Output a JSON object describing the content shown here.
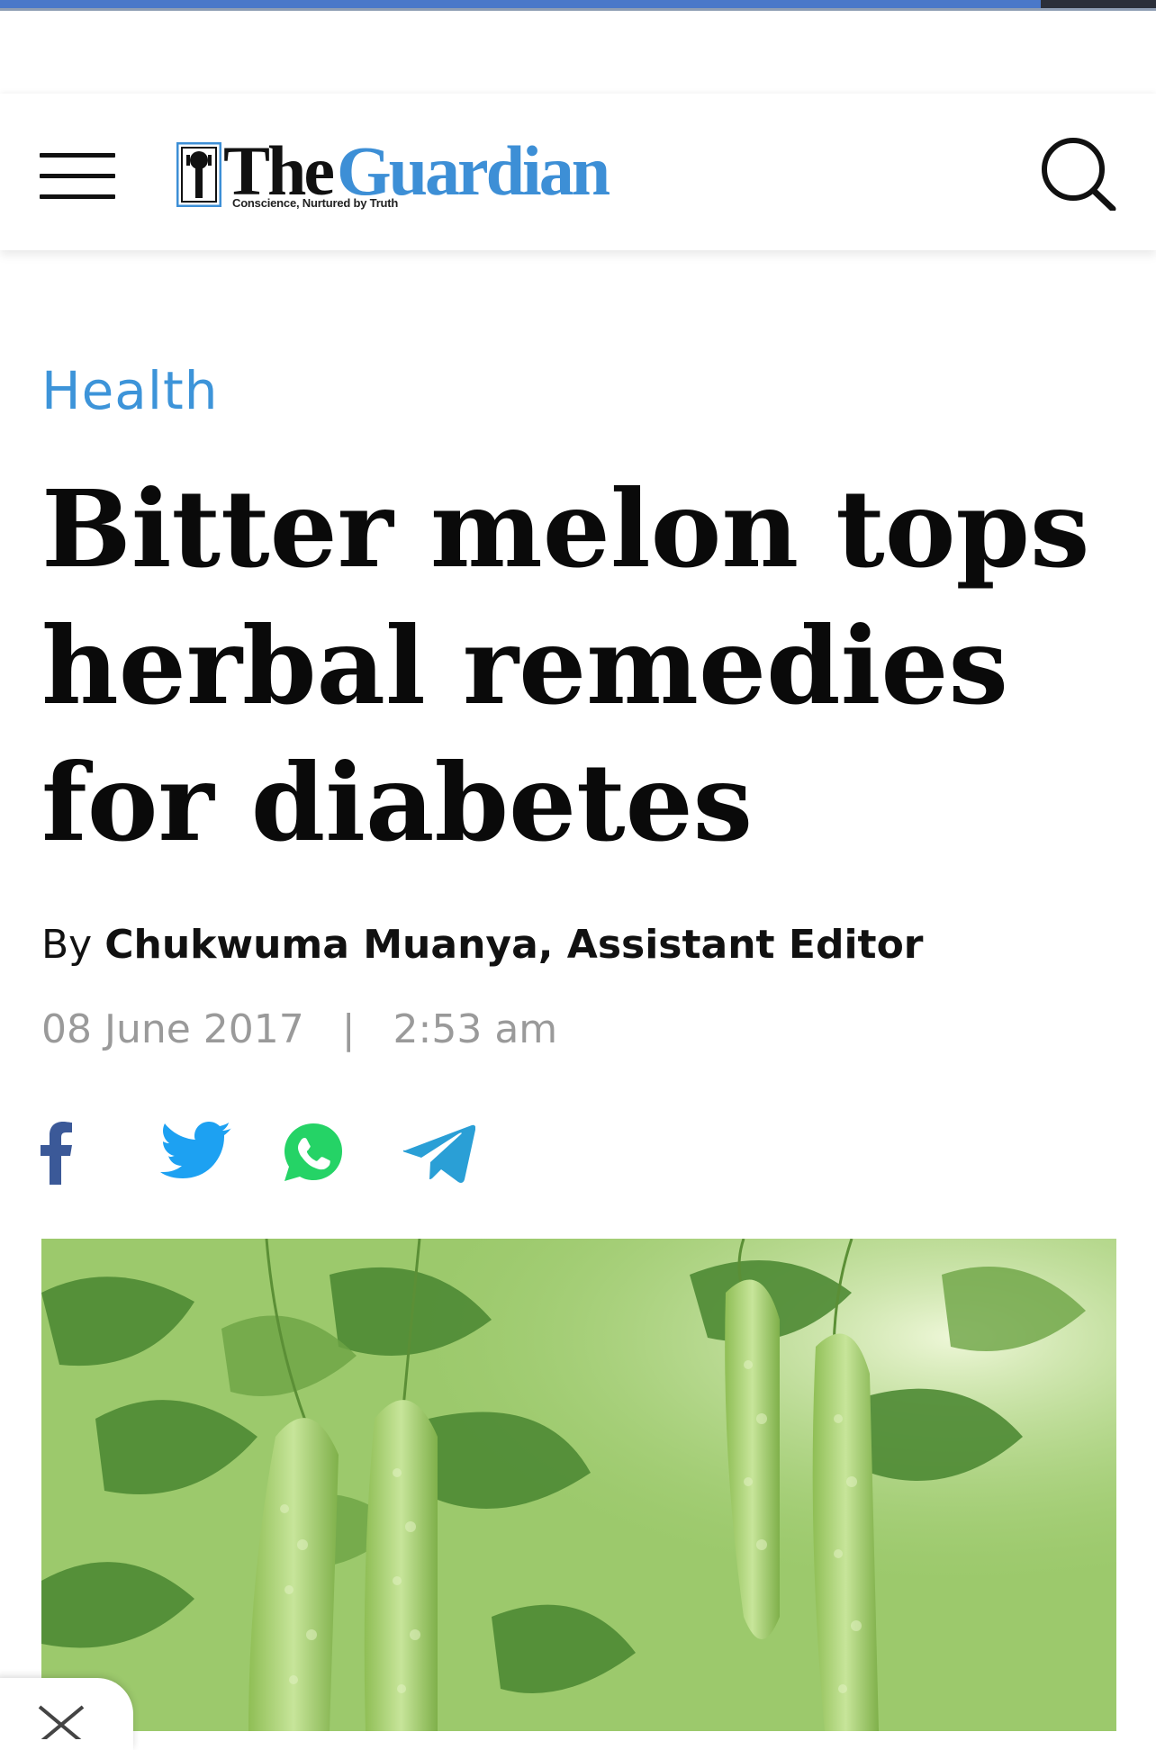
{
  "progress": {
    "fraction": 0.9
  },
  "header": {
    "menu_icon": "hamburger-menu-icon",
    "logo": {
      "the": "The",
      "guardian": "Guardian",
      "tagline": "Conscience, Nurtured by Truth"
    },
    "search_icon": "search-icon",
    "brand_color": "#3d8fd6"
  },
  "article": {
    "category": "Health",
    "headline": "Bitter melon tops herbal remedies for diabetes",
    "byline": {
      "prefix": "By",
      "author": "Chukwuma Muanya, Assistant Editor"
    },
    "date": "08 June 2017",
    "separator": "|",
    "time": "2:53 am",
    "share": [
      {
        "icon": "facebook-icon",
        "color": "#3b5998"
      },
      {
        "icon": "twitter-icon",
        "color": "#1da1f2"
      },
      {
        "icon": "whatsapp-icon",
        "color": "#25d366"
      },
      {
        "icon": "telegram-icon",
        "color": "#2a9fd6"
      }
    ],
    "hero_image": "bitter-melon-photo"
  },
  "overlay": {
    "close_icon": "close-icon"
  }
}
